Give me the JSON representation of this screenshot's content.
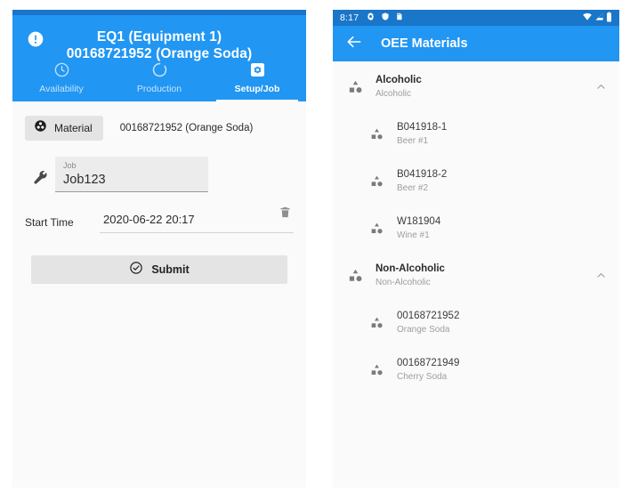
{
  "colors": {
    "primary": "#2196f3",
    "primary_dark": "#1976c8",
    "surface": "#fafafa",
    "button_grey": "#e4e4e4",
    "text_primary": "#2b2b2b",
    "text_secondary": "#9e9e9e"
  },
  "left_phone": {
    "appbar": {
      "alert_icon": "error-outline-icon",
      "title_line1": "EQ1 (Equipment 1)",
      "title_line2": "00168721952 (Orange Soda)"
    },
    "tabs": [
      {
        "label": "Availability",
        "icon": "clock-icon",
        "active": false
      },
      {
        "label": "Production",
        "icon": "loop-circle-icon",
        "active": false
      },
      {
        "label": "Setup/Job",
        "icon": "settings-square-icon",
        "active": true
      }
    ],
    "form": {
      "material_button_label": "Material",
      "material_button_icon": "bubble-chart-icon",
      "material_value": "00168721952 (Orange Soda)",
      "job_icon": "wrench-icon",
      "job_label": "Job",
      "job_value": "Job123",
      "start_time_label": "Start Time",
      "start_time_value": "2020-06-22 20:17",
      "delete_icon": "trash-icon",
      "submit_label": "Submit",
      "submit_icon": "check-circle-icon"
    }
  },
  "right_phone": {
    "status_bar": {
      "time": "8:17",
      "left_icons": [
        "gear-icon",
        "shield-icon",
        "sd-card-icon"
      ],
      "right_icons": [
        "wifi-icon",
        "cellular-signal-icon",
        "battery-icon"
      ]
    },
    "appbar": {
      "back_icon": "back-arrow-icon",
      "title": "OEE Materials"
    },
    "list": [
      {
        "type": "group",
        "primary": "Alcoholic",
        "secondary": "Alcoholic",
        "icon": "category-shapes-icon",
        "chevron": "chevron-up-icon"
      },
      {
        "type": "child",
        "primary": "B041918-1",
        "secondary": "Beer #1",
        "icon": "category-shapes-icon",
        "chevron": ""
      },
      {
        "type": "child",
        "primary": "B041918-2",
        "secondary": "Beer #2",
        "icon": "category-shapes-icon",
        "chevron": ""
      },
      {
        "type": "child",
        "primary": "W181904",
        "secondary": "Wine #1",
        "icon": "category-shapes-icon",
        "chevron": ""
      },
      {
        "type": "group",
        "primary": "Non-Alcoholic",
        "secondary": "Non-Alcoholic",
        "icon": "category-shapes-icon",
        "chevron": "chevron-up-icon"
      },
      {
        "type": "child",
        "primary": "00168721952",
        "secondary": "Orange Soda",
        "icon": "category-shapes-icon",
        "chevron": ""
      },
      {
        "type": "child",
        "primary": "00168721949",
        "secondary": "Cherry Soda",
        "icon": "category-shapes-icon",
        "chevron": ""
      }
    ]
  }
}
